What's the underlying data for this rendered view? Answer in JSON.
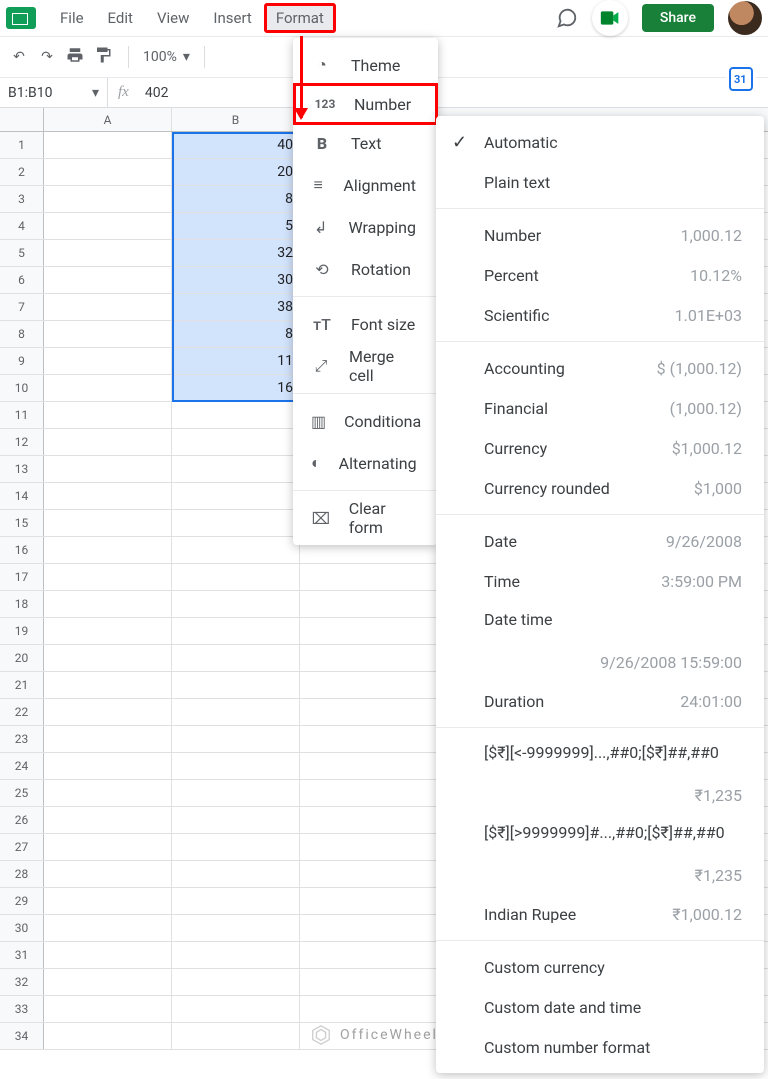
{
  "menu": {
    "items": [
      "File",
      "Edit",
      "View",
      "Insert",
      "Format"
    ],
    "highlighted_index": 4,
    "share_label": "Share"
  },
  "toolbar": {
    "zoom": "100%"
  },
  "namebox": "B1:B10",
  "fx_value": "402",
  "columns": [
    "A",
    "B"
  ],
  "row_count": 34,
  "cells_b": [
    "40",
    "20",
    "8",
    "5",
    "32",
    "30",
    "38",
    "8",
    "11",
    "16"
  ],
  "selection": {
    "col": "B",
    "row_start": 1,
    "row_end": 10
  },
  "format_menu": {
    "items": [
      {
        "icon": "palette",
        "label": "Theme"
      },
      {
        "icon": "123",
        "label": "Number",
        "boxed": true,
        "submenu": true
      },
      {
        "icon": "B",
        "label": "Text"
      },
      {
        "icon": "align",
        "label": "Alignment"
      },
      {
        "icon": "wrap",
        "label": "Wrapping"
      },
      {
        "icon": "rotate",
        "label": "Rotation"
      },
      {
        "divider": true
      },
      {
        "icon": "tT",
        "label": "Font size"
      },
      {
        "icon": "merge",
        "label": "Merge cell"
      },
      {
        "divider": true
      },
      {
        "icon": "cond",
        "label": "Conditiona"
      },
      {
        "icon": "alt",
        "label": "Alternating"
      },
      {
        "divider": true
      },
      {
        "icon": "clear",
        "label": "Clear form"
      }
    ]
  },
  "number_submenu": {
    "groups": [
      [
        {
          "label": "Automatic",
          "checked": true
        },
        {
          "label": "Plain text"
        }
      ],
      [
        {
          "label": "Number",
          "example": "1,000.12"
        },
        {
          "label": "Percent",
          "example": "10.12%"
        },
        {
          "label": "Scientific",
          "example": "1.01E+03"
        }
      ],
      [
        {
          "label": "Accounting",
          "example": "$ (1,000.12)"
        },
        {
          "label": "Financial",
          "example": "(1,000.12)"
        },
        {
          "label": "Currency",
          "example": "$1,000.12"
        },
        {
          "label": "Currency rounded",
          "example": "$1,000"
        }
      ],
      [
        {
          "label": "Date",
          "example": "9/26/2008"
        },
        {
          "label": "Time",
          "example": "3:59:00 PM"
        },
        {
          "label": "Date time",
          "example": "9/26/2008 15:59:00",
          "wrap": true
        },
        {
          "label": "Duration",
          "example": "24:01:00"
        }
      ],
      [
        {
          "label": "[$₹][<-9999999]...,##0;[$₹]##,##0",
          "example": "₹1,235",
          "wrap": true
        },
        {
          "label": "[$₹][>9999999]#...,##0;[$₹]##,##0",
          "example": "₹1,235",
          "wrap": true
        },
        {
          "label": "Indian Rupee",
          "example": "₹1,000.12"
        }
      ],
      [
        {
          "label": "Custom currency"
        },
        {
          "label": "Custom date and time"
        },
        {
          "label": "Custom number format"
        }
      ]
    ]
  },
  "watermark": "OfficeWheel"
}
